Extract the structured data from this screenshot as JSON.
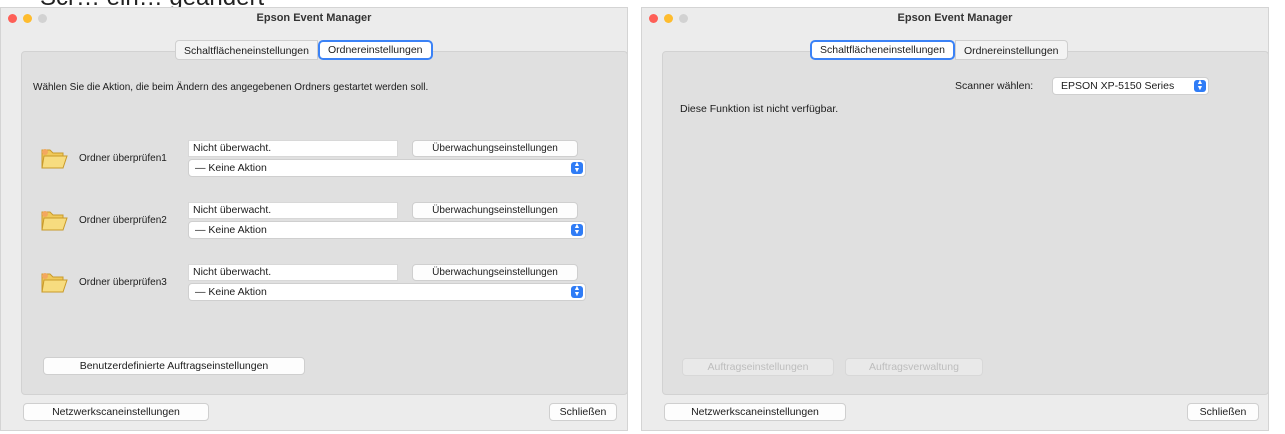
{
  "cropped_caption": "Scr… ein… geändert",
  "left_window": {
    "title": "Epson Event Manager",
    "tabs": [
      {
        "label": "Schaltflächeneinstellungen",
        "active": false
      },
      {
        "label": "Ordnereinstellungen",
        "active": true
      }
    ],
    "description": "Wählen Sie die Aktion, die beim Ändern des angegebenen Ordners gestartet werden soll.",
    "folders": [
      {
        "label": "Ordner überprüfen1",
        "status": "Nicht überwacht.",
        "watch_button": "Überwachungseinstellungen",
        "action": "— Keine Aktion"
      },
      {
        "label": "Ordner überprüfen2",
        "status": "Nicht überwacht.",
        "watch_button": "Überwachungseinstellungen",
        "action": "— Keine Aktion"
      },
      {
        "label": "Ordner überprüfen3",
        "status": "Nicht überwacht.",
        "watch_button": "Überwachungseinstellungen",
        "action": "— Keine Aktion"
      }
    ],
    "custom_job_button": "Benutzerdefinierte Auftragseinstellungen",
    "network_button": "Netzwerkscaneinstellungen",
    "close_button": "Schließen"
  },
  "right_window": {
    "title": "Epson Event Manager",
    "tabs": [
      {
        "label": "Schaltflächeneinstellungen",
        "active": true
      },
      {
        "label": "Ordnereinstellungen",
        "active": false
      }
    ],
    "scanner_label": "Scanner wählen:",
    "scanner_value": "EPSON XP-5150 Series",
    "unavailable_text": "Diese Funktion ist nicht verfügbar.",
    "job_settings_button": "Auftragseinstellungen",
    "job_management_button": "Auftragsverwaltung",
    "network_button": "Netzwerkscaneinstellungen",
    "close_button": "Schließen"
  },
  "colors": {
    "window_bg": "#ececec",
    "panel_bg": "#e0e0e0",
    "accent": "#2f7cf6",
    "close_light": "#fe5f57",
    "minimize_light": "#febc2e"
  },
  "icons": [
    "folder-icon",
    "stepper-icon"
  ]
}
